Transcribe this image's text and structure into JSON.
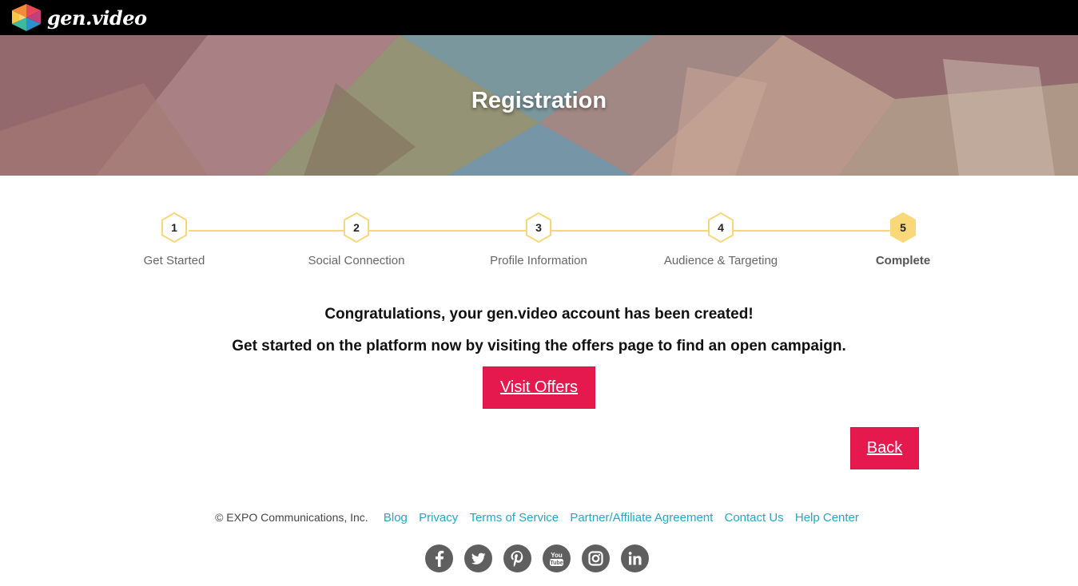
{
  "brand": {
    "name": "gen.video"
  },
  "hero": {
    "title": "Registration"
  },
  "stepper": {
    "steps": [
      {
        "number": "1",
        "label": "Get Started"
      },
      {
        "number": "2",
        "label": "Social Connection"
      },
      {
        "number": "3",
        "label": "Profile Information"
      },
      {
        "number": "4",
        "label": "Audience & Targeting"
      },
      {
        "number": "5",
        "label": "Complete"
      }
    ],
    "active_step": 5
  },
  "content": {
    "message_primary": "Congratulations, your gen.video account has been created!",
    "message_secondary": "Get started on the platform now by visiting the offers page to find an open campaign.",
    "visit_offers_label": "Visit Offers",
    "back_label": "Back"
  },
  "footer": {
    "copyright": "© EXPO Communications, Inc.",
    "links": [
      "Blog",
      "Privacy",
      "Terms of Service",
      "Partner/Affiliate Agreement",
      "Contact Us",
      "Help Center"
    ],
    "social": [
      "facebook-icon",
      "twitter-icon",
      "pinterest-icon",
      "youtube-icon",
      "instagram-icon",
      "linkedin-icon"
    ]
  },
  "colors": {
    "accent": "#e6194e",
    "link": "#23a7c7",
    "step_line": "#f7d77a",
    "step_active_fill": "#f9d87a",
    "topbar": "#000000"
  }
}
